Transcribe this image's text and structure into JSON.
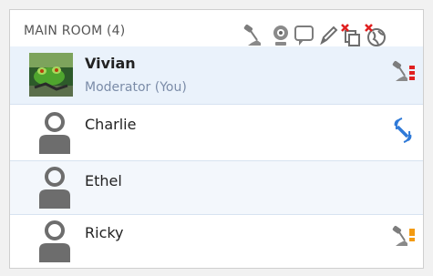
{
  "room": {
    "title": "MAIN ROOM (4)"
  },
  "toolbar": {
    "icons": [
      "microphone-icon",
      "webcam-icon",
      "chat-icon",
      "pencil-icon",
      "copy-icon",
      "globe-icon"
    ]
  },
  "participants": [
    {
      "name": "Vivian",
      "role": "Moderator (You)",
      "avatar": "photo",
      "status_icon": "muted-microphone-icon"
    },
    {
      "name": "Charlie",
      "role": "",
      "avatar": "default",
      "status_icon": "talking-icon"
    },
    {
      "name": "Ethel",
      "role": "",
      "avatar": "default",
      "status_icon": ""
    },
    {
      "name": "Ricky",
      "role": "",
      "avatar": "default",
      "status_icon": "microphone-warning-icon"
    }
  ],
  "colors": {
    "selected_row": "#eaf2fb",
    "alt_row": "#f3f7fc",
    "role_text": "#7b8ca8",
    "icon_gray": "#777777",
    "alert_red": "#e02020",
    "talk_blue": "#2f7ad8",
    "warn_orange": "#f39b12"
  }
}
